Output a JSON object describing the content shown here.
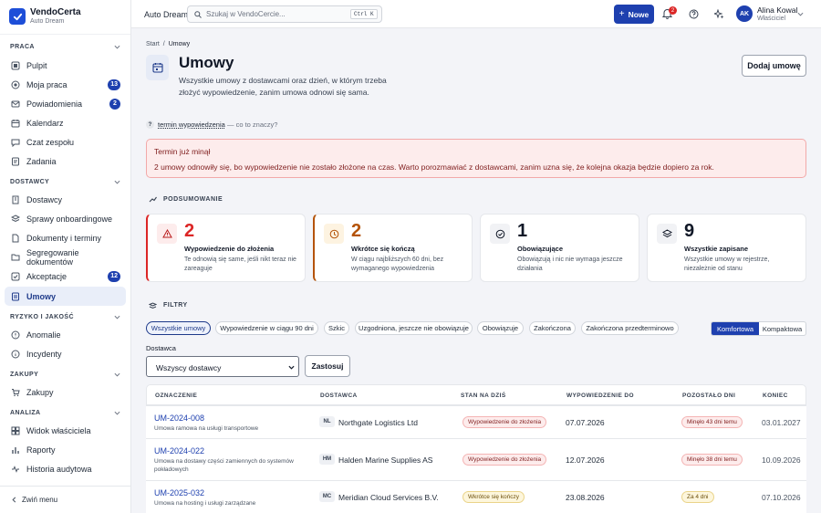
{
  "brand": {
    "name": "VendoCerta",
    "tenant": "Auto Dream"
  },
  "sidebar": {
    "sections": [
      {
        "label": "PRACA"
      },
      {
        "label": "DOSTAWCY"
      },
      {
        "label": "RYZYKO I JAKOŚĆ"
      },
      {
        "label": "ZAKUPY"
      },
      {
        "label": "ANALIZA"
      }
    ],
    "items": [
      {
        "label": "Pulpit"
      },
      {
        "label": "Moja praca",
        "badge": "13"
      },
      {
        "label": "Powiadomienia",
        "badge": "2"
      },
      {
        "label": "Kalendarz"
      },
      {
        "label": "Czat zespołu"
      },
      {
        "label": "Zadania"
      },
      {
        "label": "Dostawcy"
      },
      {
        "label": "Sprawy onboardingowe"
      },
      {
        "label": "Dokumenty i terminy"
      },
      {
        "label": "Segregowanie dokumentów"
      },
      {
        "label": "Akceptacje",
        "badge": "12"
      },
      {
        "label": "Umowy"
      },
      {
        "label": "Anomalie"
      },
      {
        "label": "Incydenty"
      },
      {
        "label": "Zakupy"
      },
      {
        "label": "Widok właściciela"
      },
      {
        "label": "Raporty"
      },
      {
        "label": "Historia audytowa"
      }
    ],
    "collapse_label": "Zwiń menu"
  },
  "topbar": {
    "workspace": "Auto Dream",
    "search_placeholder": "Szukaj w VendoCercie...",
    "shortcut": "Ctrl K",
    "new_label": "Nowe",
    "notif_count": "2",
    "user_initials": "AK",
    "user_name": "Alina Kowal",
    "user_role": "Właściciel"
  },
  "breadcrumb": {
    "home": "Start",
    "sep": "/",
    "current": "Umowy"
  },
  "page": {
    "title": "Umowy",
    "subtitle": "Wszystkie umowy z dostawcami oraz dzień, w którym trzeba złożyć wypowiedzenie, zanim umowa odnowi się sama.",
    "add_button": "Dodaj umowę",
    "help_term": "termin wypowiedzenia",
    "help_suffix": "— co to znaczy?"
  },
  "alert": {
    "title": "Termin już minął",
    "text": "2 umowy odnowiły się, bo wypowiedzenie nie zostało złożone na czas. Warto porozmawiać z dostawcami, zanim uzna się, że kolejna okazja będzie dopiero za rok."
  },
  "summary": {
    "heading": "PODSUMOWANIE",
    "cards": [
      {
        "value": "2",
        "title": "Wypowiedzenie do złożenia",
        "desc": "Te odnowią się same, jeśli nikt teraz nie zareaguje",
        "icon": "warning-icon",
        "accent": "#dc2626"
      },
      {
        "value": "2",
        "title": "Wkrótce się kończą",
        "desc": "W ciągu najbliższych 60 dni, bez wymaganego wypowiedzenia",
        "icon": "clock-icon",
        "accent": "#b45309"
      },
      {
        "value": "1",
        "title": "Obowiązujące",
        "desc": "Obowiązują i nic nie wymaga jeszcze działania",
        "icon": "check-circle-icon",
        "accent": "#111827"
      },
      {
        "value": "9",
        "title": "Wszystkie zapisane",
        "desc": "Wszystkie umowy w rejestrze, niezależnie od stanu",
        "icon": "layers-icon",
        "accent": "#111827"
      }
    ]
  },
  "filters": {
    "heading": "FILTRY",
    "pills": [
      "Wszystkie umowy",
      "Wypowiedzenie w ciągu 90 dni",
      "Szkic",
      "Uzgodniona, jeszcze nie obowiązuje",
      "Obowiązuje",
      "Zakończona",
      "Zakończona przedterminowo"
    ],
    "density": [
      "Komfortowa",
      "Kompaktowa"
    ],
    "vendor_label": "Dostawca",
    "vendor_value": "Wszyscy dostawcy",
    "apply_label": "Zastosuj"
  },
  "table": {
    "headers": [
      "OZNACZENIE",
      "DOSTAWCA",
      "STAN NA DZIŚ",
      "WYPOWIEDZENIE DO",
      "POZOSTAŁO DNI",
      "KONIEC"
    ],
    "rows": [
      {
        "id": "UM-2024-008",
        "desc": "Umowa ramowa na usługi transportowe",
        "vendor_code": "NL",
        "vendor": "Northgate Logistics Ltd",
        "status": "Wypowiedzenie do złożenia",
        "notice": "07.07.2026",
        "remaining": "Minęło 43 dni temu",
        "end": "03.01.2027"
      },
      {
        "id": "UM-2024-022",
        "desc": "Umowa na dostawy części zamiennych do systemów pokładowych",
        "vendor_code": "HM",
        "vendor": "Halden Marine Supplies AS",
        "status": "Wypowiedzenie do złożenia",
        "notice": "12.07.2026",
        "remaining": "Minęło 38 dni temu",
        "end": "10.09.2026"
      },
      {
        "id": "UM-2025-032",
        "desc": "Umowa na hosting i usługi zarządzane",
        "vendor_code": "MC",
        "vendor": "Meridian Cloud Services B.V.",
        "status": "Wkrótce się kończy",
        "notice": "23.08.2026",
        "remaining": "Za 4 dni",
        "end": "07.10.2026"
      }
    ]
  },
  "colors": {
    "accent": "#1e40af",
    "danger": "#dc2626",
    "warning": "#b45309"
  }
}
